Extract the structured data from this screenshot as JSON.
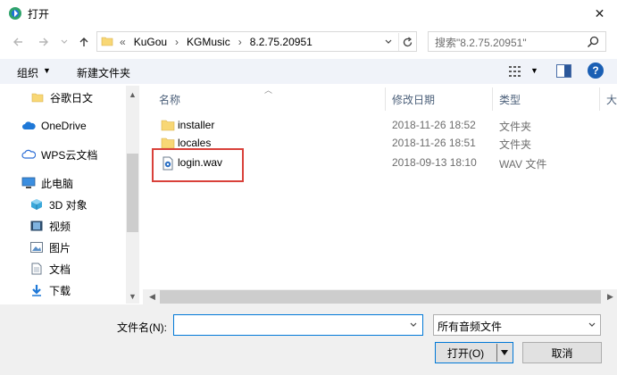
{
  "window": {
    "title": "打开",
    "close_glyph": "✕"
  },
  "address": {
    "overflow": "«",
    "crumbs": [
      "KuGou",
      "KGMusic",
      "8.2.75.20951"
    ],
    "separator": "›"
  },
  "search": {
    "placeholder": "搜索\"8.2.75.20951\""
  },
  "toolbar": {
    "organize": "组织",
    "new_folder": "新建文件夹",
    "help": "?"
  },
  "nav": {
    "items": [
      {
        "label": "谷歌日文",
        "icon": "folder-icon"
      },
      {
        "label": "OneDrive",
        "icon": "cloud-icon"
      },
      {
        "label": "WPS云文档",
        "icon": "wps-cloud-icon"
      },
      {
        "label": "此电脑",
        "icon": "computer-icon"
      },
      {
        "label": "3D 对象",
        "icon": "3d-objects-icon"
      },
      {
        "label": "视频",
        "icon": "video-icon"
      },
      {
        "label": "图片",
        "icon": "pictures-icon"
      },
      {
        "label": "文档",
        "icon": "documents-icon"
      },
      {
        "label": "下载",
        "icon": "download-icon"
      }
    ]
  },
  "columns": {
    "name": "名称",
    "modified": "修改日期",
    "type": "类型",
    "size": "大"
  },
  "files": [
    {
      "name": "installer",
      "modified": "2018-11-26 18:52",
      "type": "文件夹",
      "icon": "folder-icon"
    },
    {
      "name": "locales",
      "modified": "2018-11-26 18:51",
      "type": "文件夹",
      "icon": "folder-icon"
    },
    {
      "name": "login.wav",
      "modified": "2018-09-13 18:10",
      "type": "WAV 文件",
      "icon": "wav-file-icon"
    }
  ],
  "footer": {
    "filename_label": "文件名(N):",
    "filename_value": "",
    "filter_value": "所有音频文件",
    "open_label": "打开(O)",
    "cancel_label": "取消"
  },
  "colors": {
    "accent": "#0078d7",
    "highlight": "#d9413a",
    "folder": "#f8d775"
  }
}
